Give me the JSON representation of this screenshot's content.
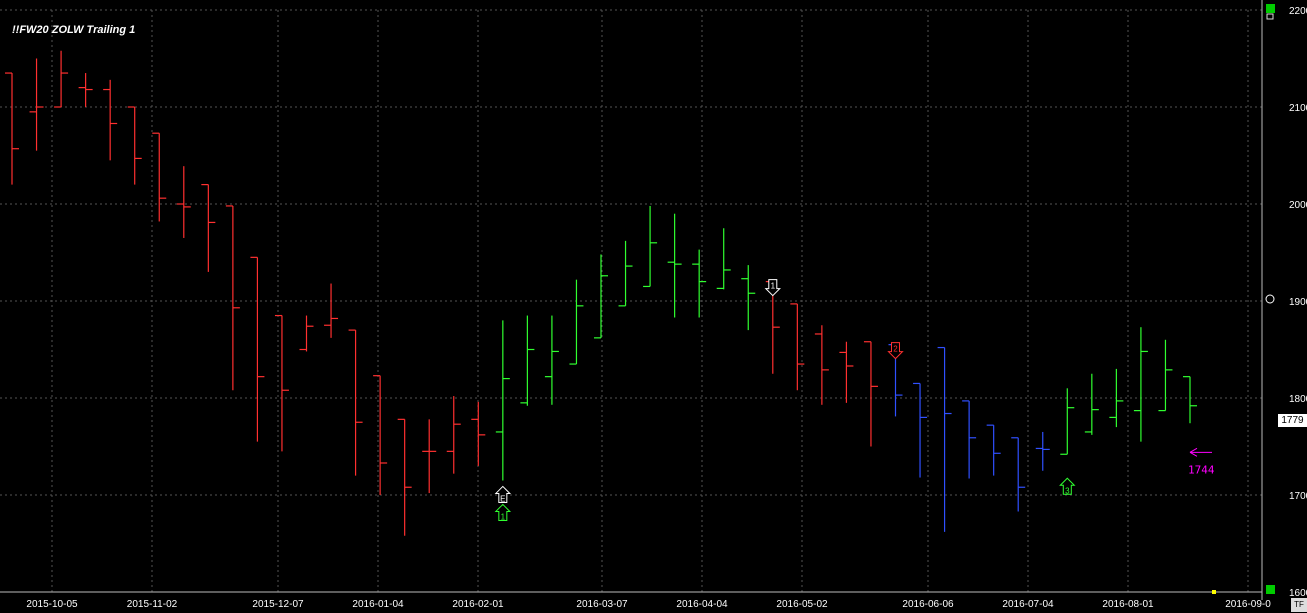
{
  "chart_data": {
    "type": "ohlc",
    "title": "!!FW20 ZOLW Trailing 1",
    "ylim": [
      1600,
      2200
    ],
    "y_ticks": [
      "2200",
      "2100",
      "2000",
      "1900",
      "1800",
      "1700",
      "1600"
    ],
    "x_ticks": [
      "2015-10-05",
      "2015-11-02",
      "2015-12-07",
      "2016-01-04",
      "2016-02-01",
      "2016-03-07",
      "2016-04-04",
      "2016-05-02",
      "2016-06-06",
      "2016-07-04",
      "2016-08-01",
      "2016-09-0"
    ],
    "grid": true,
    "current_price_label": "1779",
    "timeframe_label": "TF",
    "annotation": {
      "label": "1744",
      "value": 1744,
      "color": "#ff00ff"
    },
    "colors": {
      "down": "#ff3030",
      "up": "#30ff30",
      "neutral": "#3050ff"
    },
    "bars": [
      {
        "o": 2135,
        "h": 2135,
        "l": 2020,
        "c": 2057,
        "color": "down"
      },
      {
        "o": 2095,
        "h": 2150,
        "l": 2055,
        "c": 2100,
        "color": "down"
      },
      {
        "o": 2100,
        "h": 2158,
        "l": 2100,
        "c": 2135,
        "color": "down"
      },
      {
        "o": 2120,
        "h": 2135,
        "l": 2100,
        "c": 2118,
        "color": "down"
      },
      {
        "o": 2118,
        "h": 2128,
        "l": 2045,
        "c": 2083,
        "color": "down"
      },
      {
        "o": 2100,
        "h": 2100,
        "l": 2020,
        "c": 2047,
        "color": "down"
      },
      {
        "o": 2073,
        "h": 2073,
        "l": 1982,
        "c": 2006,
        "color": "down"
      },
      {
        "o": 2000,
        "h": 2039,
        "l": 1965,
        "c": 1997,
        "color": "down"
      },
      {
        "o": 2020,
        "h": 2020,
        "l": 1930,
        "c": 1981,
        "color": "down"
      },
      {
        "o": 1998,
        "h": 1998,
        "l": 1808,
        "c": 1893,
        "color": "down"
      },
      {
        "o": 1945,
        "h": 1945,
        "l": 1755,
        "c": 1822,
        "color": "down"
      },
      {
        "o": 1885,
        "h": 1885,
        "l": 1745,
        "c": 1808,
        "color": "down"
      },
      {
        "o": 1850,
        "h": 1885,
        "l": 1848,
        "c": 1874,
        "color": "down"
      },
      {
        "o": 1875,
        "h": 1918,
        "l": 1862,
        "c": 1882,
        "color": "down"
      },
      {
        "o": 1870,
        "h": 1870,
        "l": 1720,
        "c": 1775,
        "color": "down"
      },
      {
        "o": 1823,
        "h": 1823,
        "l": 1700,
        "c": 1733,
        "color": "down"
      },
      {
        "o": 1778,
        "h": 1778,
        "l": 1658,
        "c": 1708,
        "color": "down"
      },
      {
        "o": 1745,
        "h": 1778,
        "l": 1702,
        "c": 1745,
        "color": "down"
      },
      {
        "o": 1745,
        "h": 1802,
        "l": 1722,
        "c": 1773,
        "color": "down"
      },
      {
        "o": 1778,
        "h": 1796,
        "l": 1730,
        "c": 1762,
        "color": "down"
      },
      {
        "o": 1765,
        "h": 1880,
        "l": 1715,
        "c": 1820,
        "color": "up"
      },
      {
        "o": 1795,
        "h": 1885,
        "l": 1792,
        "c": 1850,
        "color": "up"
      },
      {
        "o": 1822,
        "h": 1885,
        "l": 1793,
        "c": 1848,
        "color": "up"
      },
      {
        "o": 1835,
        "h": 1922,
        "l": 1835,
        "c": 1895,
        "color": "up"
      },
      {
        "o": 1862,
        "h": 1948,
        "l": 1862,
        "c": 1926,
        "color": "up"
      },
      {
        "o": 1895,
        "h": 1962,
        "l": 1895,
        "c": 1936,
        "color": "up"
      },
      {
        "o": 1915,
        "h": 1998,
        "l": 1915,
        "c": 1960,
        "color": "up"
      },
      {
        "o": 1940,
        "h": 1990,
        "l": 1883,
        "c": 1938,
        "color": "up"
      },
      {
        "o": 1938,
        "h": 1953,
        "l": 1883,
        "c": 1920,
        "color": "up"
      },
      {
        "o": 1913,
        "h": 1975,
        "l": 1912,
        "c": 1932,
        "color": "up"
      },
      {
        "o": 1923,
        "h": 1937,
        "l": 1870,
        "c": 1908,
        "color": "up"
      },
      {
        "o": 1920,
        "h": 1920,
        "l": 1825,
        "c": 1873,
        "color": "down"
      },
      {
        "o": 1897,
        "h": 1897,
        "l": 1808,
        "c": 1835,
        "color": "down"
      },
      {
        "o": 1866,
        "h": 1875,
        "l": 1793,
        "c": 1829,
        "color": "down"
      },
      {
        "o": 1847,
        "h": 1858,
        "l": 1795,
        "c": 1833,
        "color": "down"
      },
      {
        "o": 1858,
        "h": 1858,
        "l": 1750,
        "c": 1812,
        "color": "down"
      },
      {
        "o": 1855,
        "h": 1855,
        "l": 1781,
        "c": 1803,
        "color": "neutral"
      },
      {
        "o": 1815,
        "h": 1815,
        "l": 1718,
        "c": 1780,
        "color": "neutral"
      },
      {
        "o": 1852,
        "h": 1852,
        "l": 1662,
        "c": 1784,
        "color": "neutral"
      },
      {
        "o": 1797,
        "h": 1797,
        "l": 1717,
        "c": 1759,
        "color": "neutral"
      },
      {
        "o": 1772,
        "h": 1772,
        "l": 1720,
        "c": 1743,
        "color": "neutral"
      },
      {
        "o": 1759,
        "h": 1759,
        "l": 1683,
        "c": 1708,
        "color": "neutral"
      },
      {
        "o": 1748,
        "h": 1765,
        "l": 1725,
        "c": 1747,
        "color": "neutral"
      },
      {
        "o": 1742,
        "h": 1810,
        "l": 1742,
        "c": 1790,
        "color": "up"
      },
      {
        "o": 1765,
        "h": 1825,
        "l": 1762,
        "c": 1788,
        "color": "up"
      },
      {
        "o": 1780,
        "h": 1830,
        "l": 1770,
        "c": 1797,
        "color": "up"
      },
      {
        "o": 1787,
        "h": 1873,
        "l": 1755,
        "c": 1848,
        "color": "up"
      },
      {
        "o": 1787,
        "h": 1860,
        "l": 1787,
        "c": 1829,
        "color": "up"
      },
      {
        "o": 1822,
        "h": 1822,
        "l": 1774,
        "c": 1792,
        "color": "up"
      }
    ],
    "signals": [
      {
        "label": "1",
        "bar_index": 20,
        "dir": "up",
        "color": "#30ff30"
      },
      {
        "label": "E",
        "bar_index": 20,
        "dir": "up",
        "color": "#ffffff"
      },
      {
        "label": "1",
        "bar_index": 31,
        "dir": "down",
        "color": "#ffffff"
      },
      {
        "label": "2",
        "bar_index": 36,
        "dir": "down",
        "color": "#ff3030"
      },
      {
        "label": "3",
        "bar_index": 43,
        "dir": "up",
        "color": "#30ff30"
      }
    ]
  }
}
